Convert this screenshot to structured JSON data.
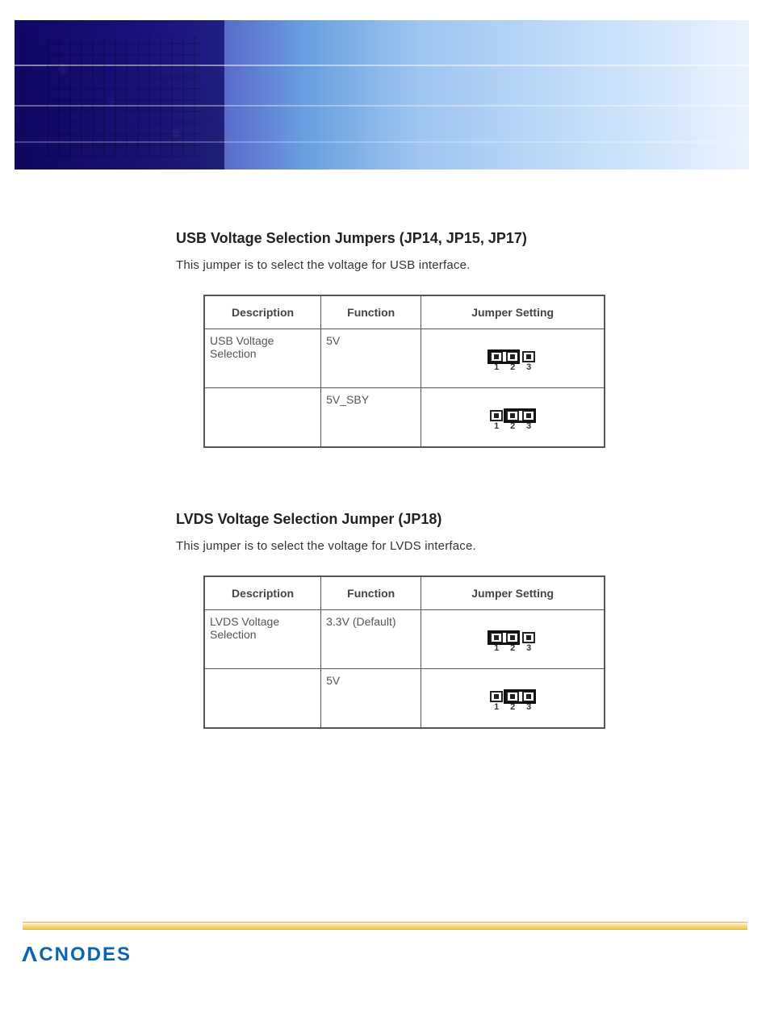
{
  "sections": [
    {
      "title": "USB Voltage Selection Jumpers (JP14, JP15, JP17)",
      "desc": "This jumper is to select the voltage for USB interface.",
      "table": {
        "headers": [
          "Description",
          "Function",
          "Jumper Setting"
        ],
        "rows": [
          {
            "description": "USB Voltage Selection",
            "function": "5V",
            "jumper_short": "1-2"
          },
          {
            "description": "",
            "function": "5V_SBY",
            "jumper_short": "2-3"
          }
        ]
      }
    },
    {
      "title": "LVDS Voltage Selection Jumper (JP18)",
      "desc": "This jumper is to select the voltage for LVDS interface.",
      "table": {
        "headers": [
          "Description",
          "Function",
          "Jumper Setting"
        ],
        "rows": [
          {
            "description": "LVDS Voltage Selection",
            "function": "3.3V (Default)",
            "jumper_short": "1-2"
          },
          {
            "description": "",
            "function": "5V",
            "jumper_short": "2-3"
          }
        ]
      }
    }
  ],
  "pin_labels": [
    "1",
    "2",
    "3"
  ],
  "footer_logo": "CNODES"
}
